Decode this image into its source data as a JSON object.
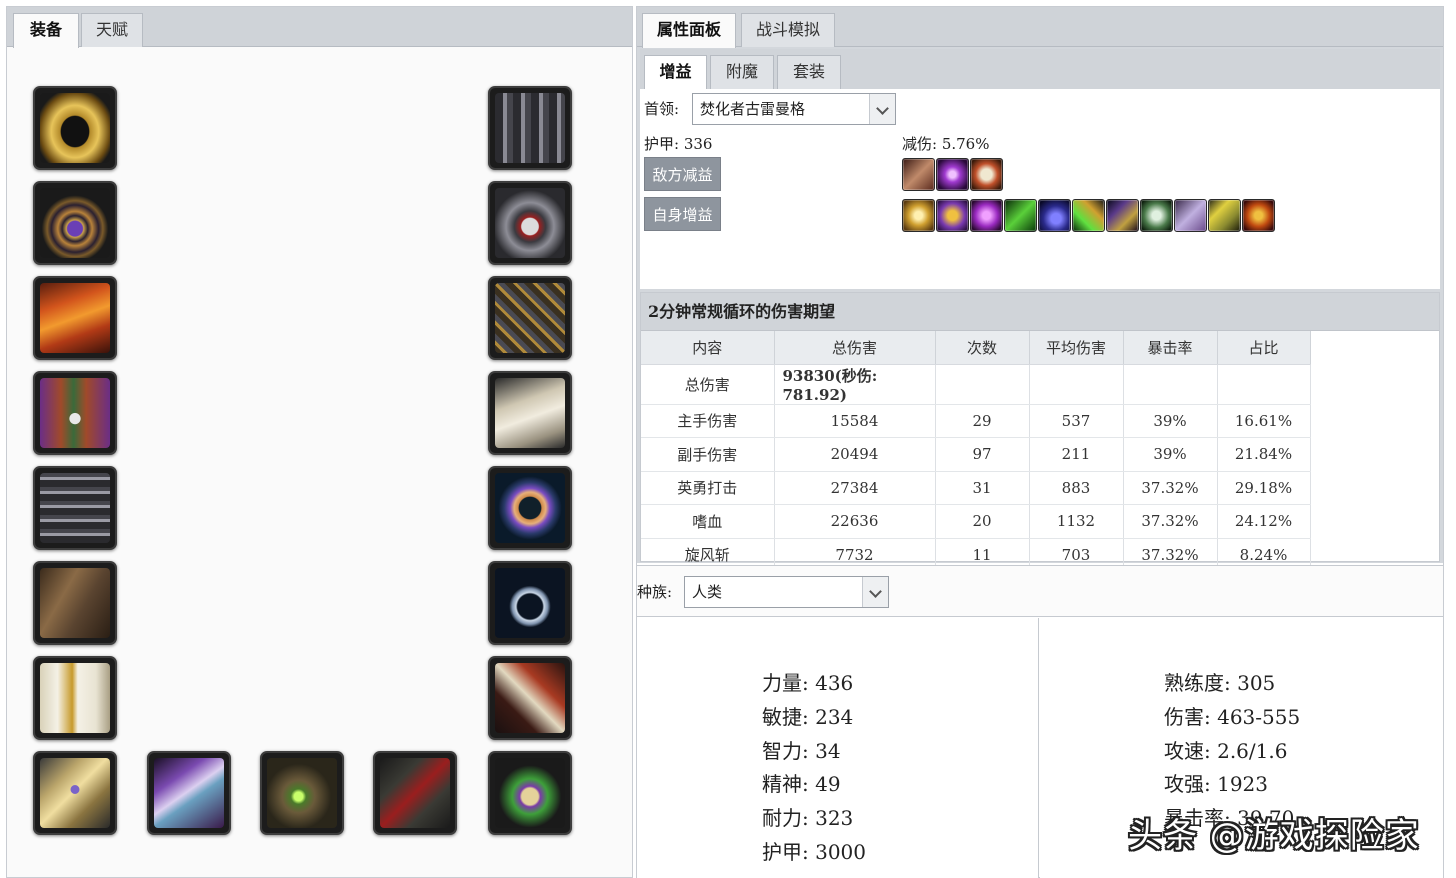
{
  "left": {
    "tabs": [
      {
        "label": "装备"
      },
      {
        "label": "天赋"
      }
    ],
    "equipment_slots": [
      {
        "icon": "gold-helm-icon"
      },
      {
        "icon": "amulet-necklace-icon"
      },
      {
        "icon": "fire-shoulders-icon"
      },
      {
        "icon": "skull-tabard-cloak-icon"
      },
      {
        "icon": "spiked-chestplate-icon"
      },
      {
        "icon": "leather-cloak-icon"
      },
      {
        "icon": "white-shirt-icon"
      },
      {
        "icon": "bracer-icon"
      },
      {
        "icon": "spiked-gauntlets-icon"
      },
      {
        "icon": "skull-belt-icon"
      },
      {
        "icon": "chain-legs-icon"
      },
      {
        "icon": "plate-boots-icon"
      },
      {
        "icon": "purple-ring-icon"
      },
      {
        "icon": "silver-ring-icon"
      },
      {
        "icon": "claw-fang-icon"
      },
      {
        "icon": "purple-skull-trinket-icon"
      },
      {
        "icon": "crystal-sword-icon"
      },
      {
        "icon": "green-skull-axe-icon"
      },
      {
        "icon": "red-axe-icon"
      }
    ]
  },
  "right": {
    "tabs": [
      {
        "label": "属性面板"
      },
      {
        "label": "战斗模拟"
      }
    ],
    "subtabs": [
      {
        "label": "增益"
      },
      {
        "label": "附魔"
      },
      {
        "label": "套装"
      }
    ],
    "boss_label": "首领:",
    "boss_value": "焚化者古雷曼格",
    "armor_label": "护甲: 336",
    "reduction_label": "减伤: 5.76%",
    "enemy_debuff_button": "敌方减益",
    "self_buff_button": "自身增益",
    "debuff_icons": [
      "sunder-armor-icon",
      "curse-icon",
      "faerie-fire-icon"
    ],
    "buff_icons": [
      "blessing-might-icon",
      "blessing-kings-icon",
      "mark-of-wild-icon",
      "green-leaf-icon",
      "potion-icon",
      "elixir-icon",
      "shadow-icon",
      "horn-icon",
      "weapon-buff-icon",
      "sharpening-stone-icon",
      "battle-shout-icon"
    ],
    "damage": {
      "title": "2分钟常规循环的伤害期望",
      "columns": [
        "内容",
        "总伤害",
        "次数",
        "平均伤害",
        "暴击率",
        "占比"
      ],
      "rows": [
        {
          "name": "总伤害",
          "total": "93830(秒伤: 781.92)",
          "count": "",
          "avg": "",
          "crit": "",
          "pct": ""
        },
        {
          "name": "主手伤害",
          "total": "15584",
          "count": "29",
          "avg": "537",
          "crit": "39%",
          "pct": "16.61%"
        },
        {
          "name": "副手伤害",
          "total": "20494",
          "count": "97",
          "avg": "211",
          "crit": "39%",
          "pct": "21.84%"
        },
        {
          "name": "英勇打击",
          "total": "27384",
          "count": "31",
          "avg": "883",
          "crit": "37.32%",
          "pct": "29.18%"
        },
        {
          "name": "嗜血",
          "total": "22636",
          "count": "20",
          "avg": "1132",
          "crit": "37.32%",
          "pct": "24.12%"
        },
        {
          "name": "旋风斩",
          "total": "7732",
          "count": "11",
          "avg": "703",
          "crit": "37.32%",
          "pct": "8.24%"
        }
      ]
    },
    "race_label": "种族:",
    "race_value": "人类",
    "stats_left": [
      "力量: 436",
      "敏捷: 234",
      "智力: 34",
      "精神: 49",
      "耐力: 323",
      "护甲: 3000"
    ],
    "stats_right": [
      "熟练度: 305",
      "伤害: 463-555",
      "攻速: 2.6/1.6",
      "攻强: 1923",
      "暴击率: 39.70"
    ]
  },
  "watermark": "头条 @游戏探险家",
  "colors": {
    "tab_bar": "#cfd3d8",
    "button_gray": "#8e959e",
    "panel_bg": "#fafafa"
  }
}
